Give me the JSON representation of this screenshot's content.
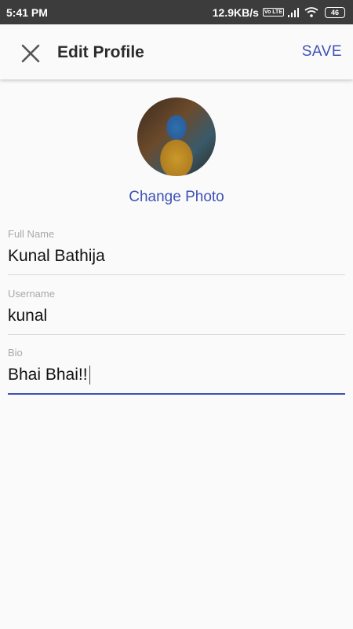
{
  "status_bar": {
    "time": "5:41 PM",
    "net_speed": "12.9KB/s",
    "volte": "Vo LTE",
    "battery": "46"
  },
  "header": {
    "title": "Edit Profile",
    "save_label": "SAVE",
    "close_icon": "close-icon"
  },
  "profile": {
    "change_photo_label": "Change Photo"
  },
  "form": {
    "full_name": {
      "label": "Full Name",
      "value": "Kunal Bathija"
    },
    "username": {
      "label": "Username",
      "value": "kunal"
    },
    "bio": {
      "label": "Bio",
      "value": "Bhai Bhai!!"
    }
  },
  "colors": {
    "accent": "#3f51b5",
    "status_bar": "#3c3c3c",
    "background": "#fafafa"
  }
}
